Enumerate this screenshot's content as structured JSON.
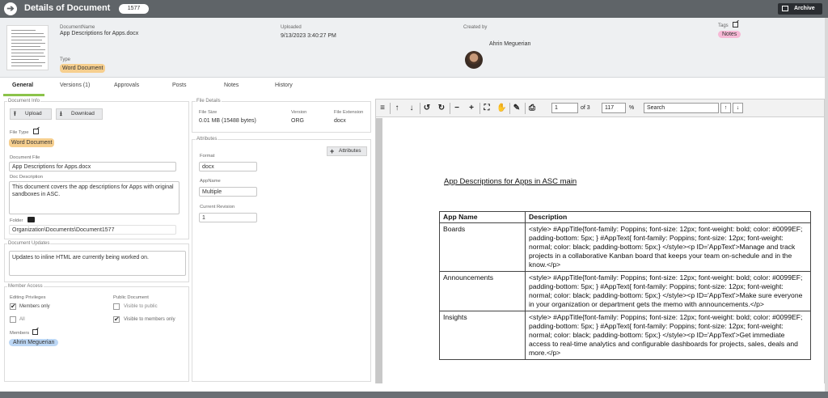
{
  "titlebar": {
    "title": "Details of Document",
    "id": "1577",
    "archive_label": "Archive"
  },
  "header": {
    "document_name_label": "DocumentName",
    "document_name": "App Descriptions for Apps.docx",
    "type_label": "Type",
    "type_value": "Word Document",
    "uploaded_label": "Uploaded",
    "uploaded_value": "9/13/2023 3:40:27 PM",
    "created_by_label": "Created by",
    "created_by_value": "Ahrin Meguerian",
    "tags_label": "Tags",
    "tag_value": "Notes"
  },
  "tabs": [
    "General",
    "Versions (1)",
    "Approvals",
    "Posts",
    "Notes",
    "History"
  ],
  "doc_info": {
    "legend": "Document Info",
    "upload_label": "Upload",
    "download_label": "Download",
    "file_type_label": "File Type",
    "file_type_value": "Word Document",
    "document_file_label": "Document File",
    "document_file_value": "App Descriptions for Apps.docx",
    "doc_description_label": "Doc Description",
    "doc_description_value": "This document covers the app descriptions for Apps with original sandboxes in ASC.",
    "folder_label": "Folder",
    "folder_value": "Organization\\Documents\\Document1577"
  },
  "doc_updates": {
    "legend": "Document Updates",
    "value": "Updates to inline HTML are currently being worked on."
  },
  "member_access": {
    "legend": "Member Access",
    "editing_label": "Editing Privileges",
    "members_only_label": "Members only",
    "all_label": "All",
    "public_label": "Public Document",
    "visible_public_label": "Visible to public",
    "visible_members_label": "Visible to members only",
    "members_label": "Members",
    "member_value": "Ahrin Meguerian"
  },
  "file_details": {
    "legend": "File Details",
    "size_label": "File Size",
    "size_value": "0.01 MB (15488 bytes)",
    "version_label": "Version",
    "version_value": "ORG",
    "ext_label": "File Extension",
    "ext_value": "docx"
  },
  "attributes": {
    "legend": "Attributes",
    "add_label": "Attributes",
    "format_label": "Format",
    "format_value": "docx",
    "appname_label": "AppName",
    "appname_value": "Multiple",
    "revision_label": "Current Revision",
    "revision_value": "1"
  },
  "viewer": {
    "page_value": "1",
    "of_label": "of 3",
    "zoom_value": "117",
    "percent_label": "%",
    "search_value": "Search"
  },
  "doc": {
    "title": "App Descriptions for Apps in ASC main",
    "col_app": "App Name",
    "col_desc": "Description",
    "rows": [
      {
        "app": "Boards",
        "desc": "<style> #AppTitle{font-family: Poppins; font-size: 12px; font-weight: bold; color: #0099EF; padding-bottom: 5px; } #AppText{ font-family: Poppins; font-size: 12px; font-weight: normal; color: black; padding-bottom: 5px;} </style><p ID='AppText'>Manage and track projects in a collaborative Kanban board that keeps your team on-schedule and in the know.</p>"
      },
      {
        "app": "Announcements",
        "desc": "<style> #AppTitle{font-family: Poppins; font-size: 12px; font-weight: bold; color: #0099EF; padding-bottom: 5px; } #AppText{ font-family: Poppins; font-size: 12px; font-weight: normal; color: black; padding-bottom: 5px;} </style><p ID='AppText'>Make sure everyone in your organization or department gets the memo with announcements.</p>"
      },
      {
        "app": "Insights",
        "desc": "<style> #AppTitle{font-family: Poppins; font-size: 12px; font-weight: bold; color: #0099EF; padding-bottom: 5px; } #AppText{ font-family: Poppins; font-size: 12px; font-weight: normal; color: black; padding-bottom: 5px;} </style><p ID='AppText'>Get immediate access to real-time analytics and configurable dashboards for projects, sales, deals and more.</p>"
      }
    ]
  },
  "colors": {
    "titlebar": "#5f6468",
    "tab_accent": "#8bc34a",
    "type_badge": "#f6cf8f",
    "tag_badge": "#f7b9d6",
    "member_badge": "#bcd7f5"
  },
  "icons": [
    "back-arrow-icon",
    "archive-icon",
    "edit-icon",
    "folder-icon",
    "upload-icon",
    "download-icon",
    "plus-icon"
  ]
}
